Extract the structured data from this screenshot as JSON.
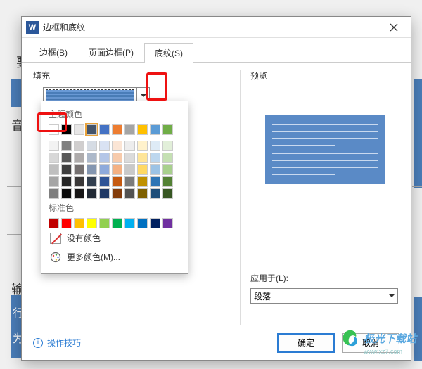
{
  "background": {
    "text_yao": "要",
    "text_yin": "音",
    "text_shu": "输",
    "text_xing": "行",
    "text_wei": "为"
  },
  "dialog": {
    "title": "边框和底纹",
    "tabs": {
      "borders": "边框(B)",
      "page_borders": "页面边框(P)",
      "shading": "底纹(S)"
    },
    "fill_label": "填充",
    "preview_label": "预览",
    "apply_to_label": "应用于(L):",
    "apply_to_value": "段落"
  },
  "color_popup": {
    "theme_label": "主题颜色",
    "standard_label": "标准色",
    "no_color": "没有颜色",
    "more_colors": "更多颜色(M)...",
    "theme_row1": [
      "#ffffff",
      "#000000",
      "#e7e6e6",
      "#44546a",
      "#4472c4",
      "#ed7d31",
      "#a5a5a5",
      "#ffc000",
      "#5b9bd5",
      "#70ad47"
    ],
    "theme_shades": [
      [
        "#f2f2f2",
        "#7f7f7f",
        "#d0cece",
        "#d6dce4",
        "#d9e2f3",
        "#fbe5d5",
        "#ededed",
        "#fff2cc",
        "#deebf6",
        "#e2efd9"
      ],
      [
        "#d8d8d8",
        "#595959",
        "#aeabab",
        "#adb9ca",
        "#b4c6e7",
        "#f7cbac",
        "#dbdbdb",
        "#fee599",
        "#bdd7ee",
        "#c5e0b3"
      ],
      [
        "#bfbfbf",
        "#3f3f3f",
        "#757070",
        "#8496b0",
        "#8eaadb",
        "#f4b183",
        "#c9c9c9",
        "#ffd965",
        "#9cc3e5",
        "#a8d08d"
      ],
      [
        "#a5a5a5",
        "#262626",
        "#3a3838",
        "#323f4f",
        "#2f5496",
        "#c55a11",
        "#7b7b7b",
        "#bf9000",
        "#2e75b5",
        "#538135"
      ],
      [
        "#7f7f7f",
        "#0c0c0c",
        "#171616",
        "#222a35",
        "#1f3864",
        "#833c0b",
        "#525252",
        "#7f6000",
        "#1e4e79",
        "#375623"
      ]
    ],
    "standard": [
      "#c00000",
      "#ff0000",
      "#ffc000",
      "#ffff00",
      "#92d050",
      "#00b050",
      "#00b0f0",
      "#0070c0",
      "#002060",
      "#7030a0"
    ]
  },
  "footer": {
    "tips": "操作技巧",
    "ok": "确定",
    "cancel": "取消"
  },
  "watermark": {
    "text": "极光下载站",
    "url": "www.xz7.com"
  }
}
